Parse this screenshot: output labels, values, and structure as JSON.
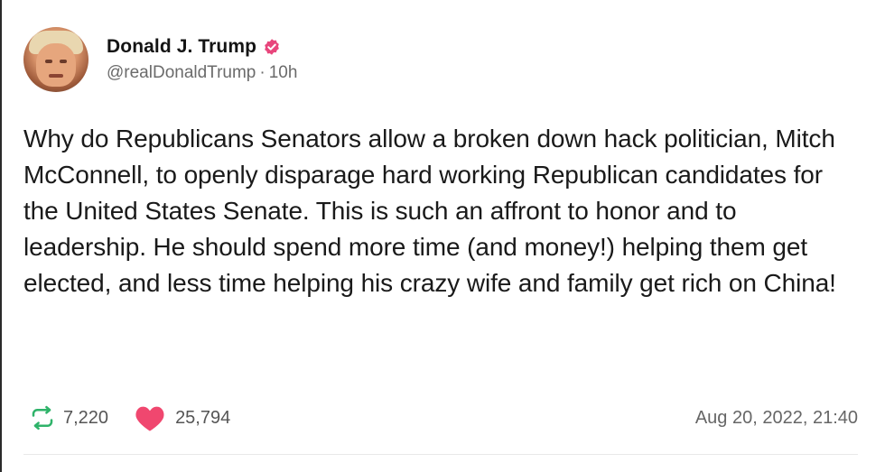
{
  "post": {
    "author": {
      "display_name": "Donald J. Trump",
      "verified": true,
      "handle": "@realDonaldTrump",
      "separator": "·",
      "relative_time": "10h"
    },
    "text": "Why do Republicans Senators allow a broken down hack politician, Mitch McConnell, to openly disparage hard working Republican candidates for the United States Senate. This is such an affront to honor and to leadership. He should spend more time (and money!) helping them get elected, and less time helping his crazy wife and family get rich on China!",
    "stats": {
      "reposts": "7,220",
      "likes": "25,794"
    },
    "timestamp": "Aug 20, 2022, 21:40"
  },
  "icons": {
    "avatar": "avatar-photo",
    "verified": "verified-badge-icon",
    "repost": "repost-icon",
    "like": "heart-icon"
  },
  "colors": {
    "verified_badge": "#e8467c",
    "repost_icon": "#2fb36a",
    "like_icon": "#f0476f",
    "primary_text": "#1a1a1a",
    "secondary_text": "#6b6b6b"
  }
}
